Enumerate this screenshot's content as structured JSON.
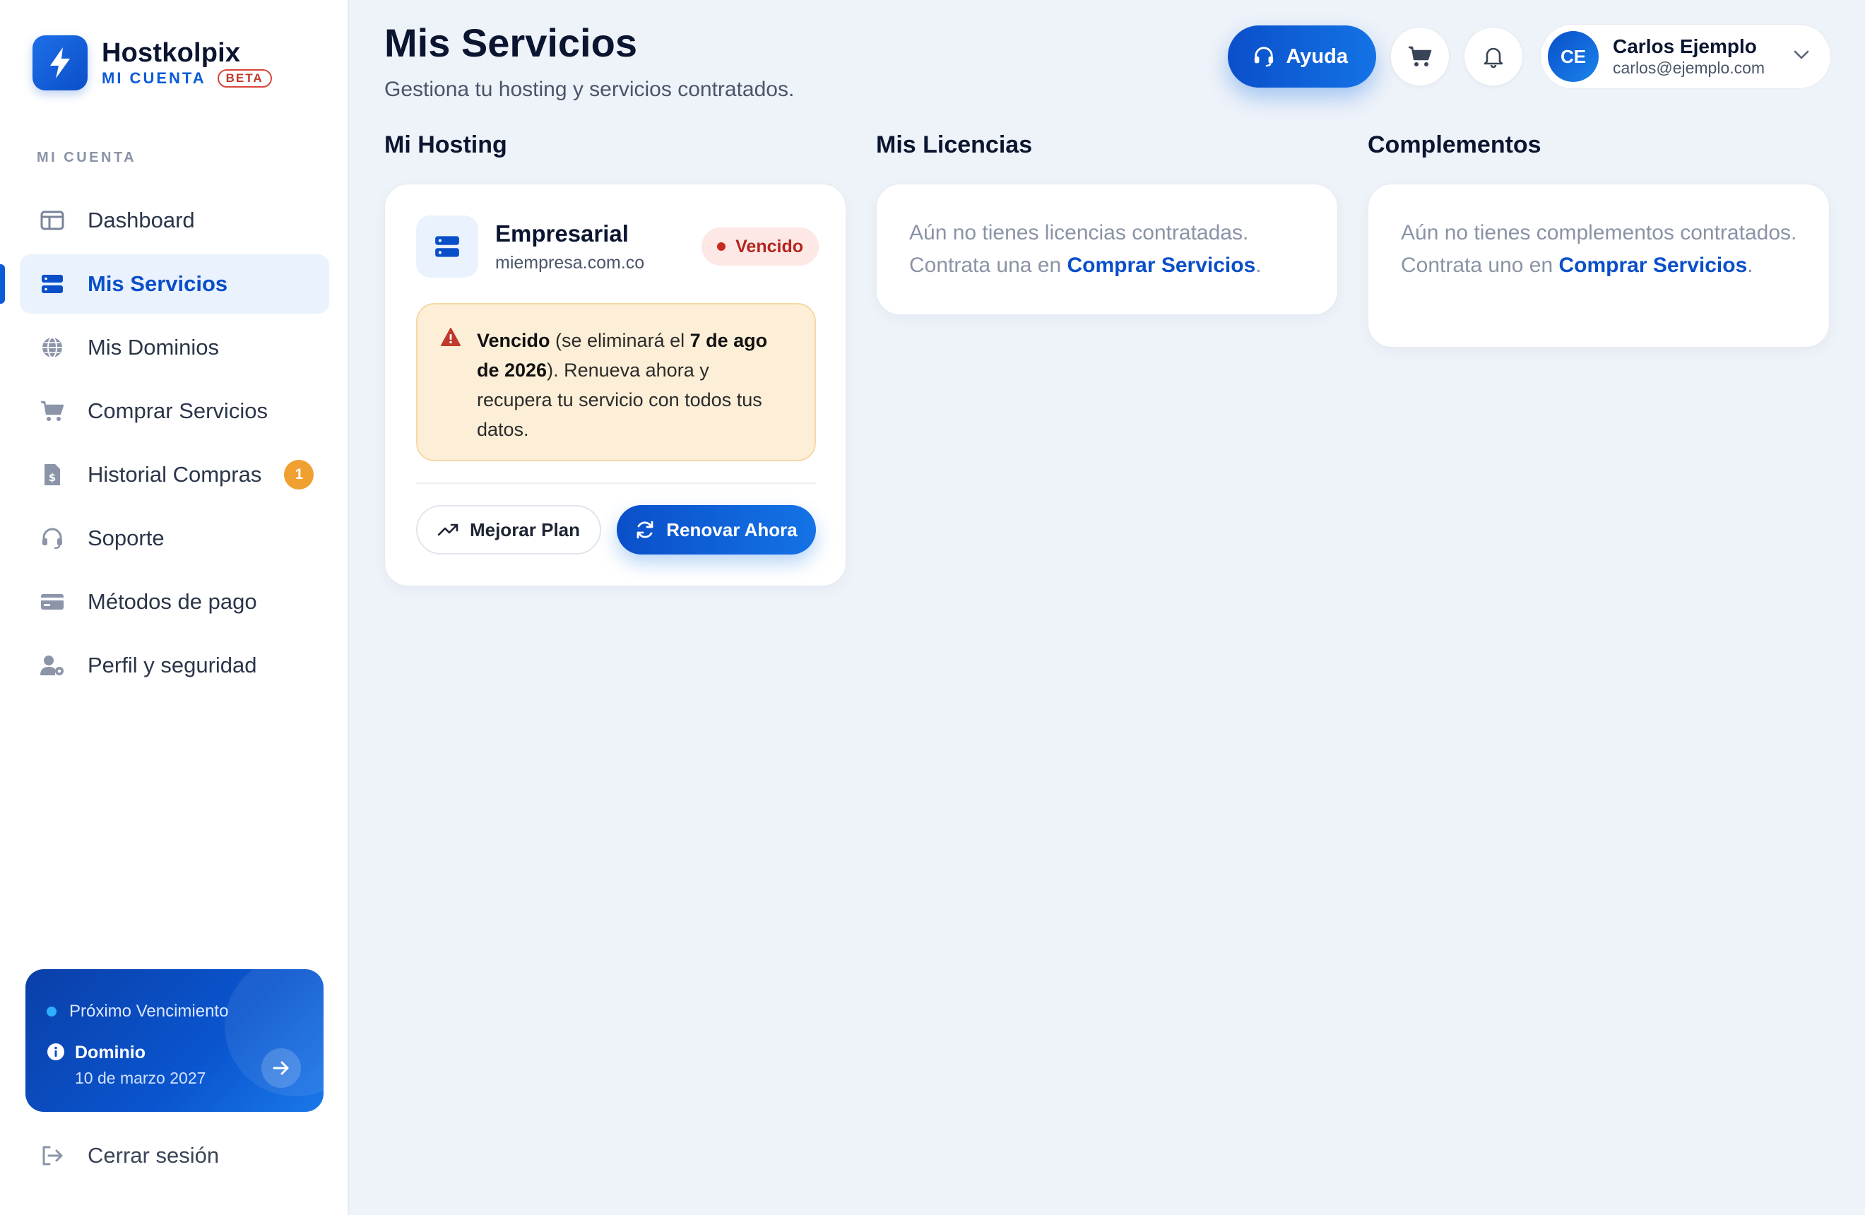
{
  "brand": {
    "name": "Hostkolpix",
    "sub_label": "MI CUENTA",
    "beta": "BETA"
  },
  "sidebar": {
    "section_label": "MI CUENTA",
    "items": [
      {
        "label": "Dashboard",
        "icon": "layout-icon",
        "active": false
      },
      {
        "label": "Mis Servicios",
        "icon": "server-icon",
        "active": true
      },
      {
        "label": "Mis Dominios",
        "icon": "globe-icon",
        "active": false
      },
      {
        "label": "Comprar Servicios",
        "icon": "cart-icon",
        "active": false
      },
      {
        "label": "Historial Compras",
        "icon": "invoice-icon",
        "active": false,
        "badge": "1"
      },
      {
        "label": "Soporte",
        "icon": "headset-icon",
        "active": false
      },
      {
        "label": "Métodos de pago",
        "icon": "credit-card-icon",
        "active": false
      },
      {
        "label": "Perfil y seguridad",
        "icon": "user-gear-icon",
        "active": false
      }
    ],
    "renewal": {
      "title": "Próximo Vencimiento",
      "type": "Dominio",
      "date": "10 de marzo 2027"
    },
    "logout_label": "Cerrar sesión"
  },
  "header": {
    "title": "Mis Servicios",
    "subtitle": "Gestiona tu hosting y servicios contratados.",
    "help_label": "Ayuda",
    "user": {
      "initials": "CE",
      "name": "Carlos Ejemplo",
      "email": "carlos@ejemplo.com"
    }
  },
  "columns": {
    "hosting": {
      "title": "Mi Hosting",
      "plan": "Empresarial",
      "domain": "miempresa.com.co",
      "status": "Vencido",
      "alert": {
        "status_word": "Vencido",
        "pre_date": " (se eliminará el ",
        "date": "7 de ago de 2026",
        "post_date": "). Renueva ahora y recupera tu servicio con todos tus datos."
      },
      "upgrade_label": "Mejorar Plan",
      "renew_label": "Renovar Ahora"
    },
    "licenses": {
      "title": "Mis Licencias",
      "empty_text": "Aún no tienes licencias contratadas. Contrata una en ",
      "link": "Comprar Servicios",
      "suffix": "."
    },
    "addons": {
      "title": "Complementos",
      "empty_text": "Aún no tienes complementos contratados. Contrata uno en ",
      "link": "Comprar Servicios",
      "suffix": "."
    }
  },
  "colors": {
    "accent": "#0a4fc9",
    "danger": "#b3261e",
    "warning_bg": "#fdefd7",
    "badge": "#f0a030"
  }
}
